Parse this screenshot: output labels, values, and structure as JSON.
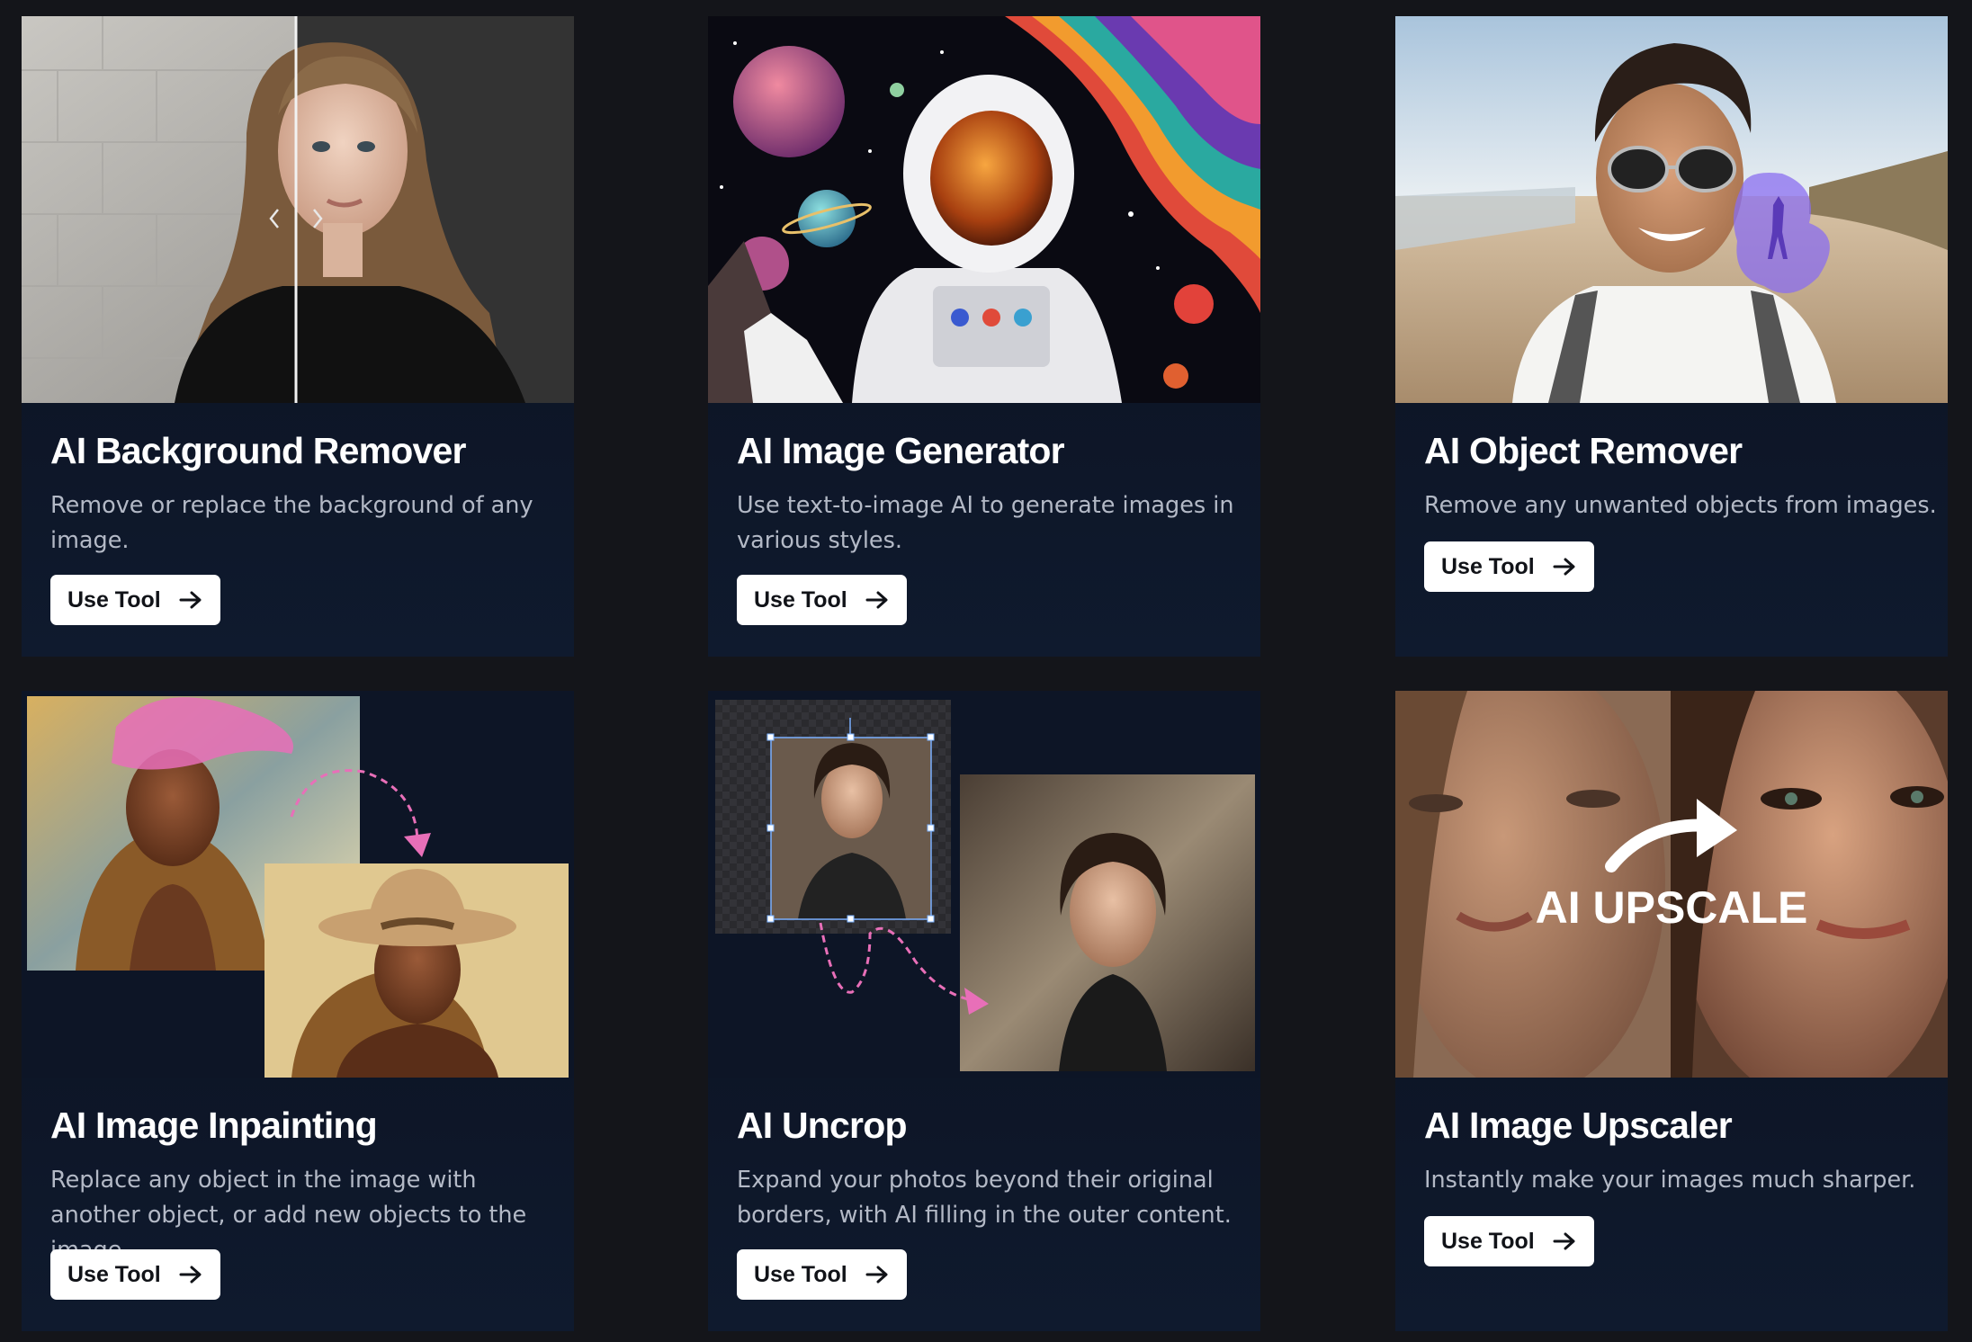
{
  "tools": [
    {
      "title": "AI Background Remover",
      "description": "Remove or replace the background of any image.",
      "button_label": "Use Tool"
    },
    {
      "title": "AI Image Generator",
      "description": "Use text-to-image AI to generate images in various styles.",
      "button_label": "Use Tool"
    },
    {
      "title": "AI Object Remover",
      "description": "Remove any unwanted objects from images.",
      "button_label": "Use Tool"
    },
    {
      "title": "AI Image Inpainting",
      "description": "Replace any object in the image with another object, or add new objects to the image.",
      "button_label": "Use Tool"
    },
    {
      "title": "AI Uncrop",
      "description": "Expand your photos beyond their original borders, with AI filling in the outer content.",
      "button_label": "Use Tool"
    },
    {
      "title": "AI Image Upscaler",
      "description": "Instantly make your images much sharper.",
      "button_label": "Use Tool"
    }
  ],
  "upscale_overlay_text": "AI UPSCALE",
  "colors": {
    "page_background": "#14151a",
    "card_background": "#0f1627",
    "title": "#ffffff",
    "description": "#b3b9c6",
    "button_background": "#ffffff",
    "button_text": "#111318",
    "accent_pink": "#e86fb8",
    "accent_purple": "#8a6df0"
  },
  "icons": [
    "arrow-right-icon",
    "chevron-left-icon",
    "chevron-right-icon",
    "curved-arrow-icon"
  ]
}
